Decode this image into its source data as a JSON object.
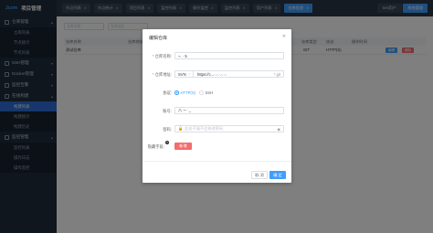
{
  "logo": {
    "mark": "Jcom",
    "title": "项目管理"
  },
  "sidebar": {
    "groups": [
      {
        "label": "仓库管理",
        "items": [
          "仓库列表",
          "节点统计",
          "节点列表"
        ]
      },
      {
        "label": "SSH管理",
        "items": []
      },
      {
        "label": "Docker管理",
        "items": []
      },
      {
        "label": "监控告警",
        "items": []
      },
      {
        "label": "在线构建",
        "items": [
          "构建列表",
          "构建统计",
          "构建历史"
        ]
      },
      {
        "label": "监控管理",
        "items": [
          "监控列表",
          "操作日志",
          "操作监控"
        ]
      }
    ],
    "active_item": "构建列表"
  },
  "topbar": {
    "tabs": [
      {
        "label": "节点列表",
        "active": false
      },
      {
        "label": "节点统计",
        "active": false
      },
      {
        "label": "项目列表",
        "active": false
      },
      {
        "label": "监控列表",
        "active": false
      },
      {
        "label": "操作监控",
        "active": false
      },
      {
        "label": "监控列表",
        "active": false
      },
      {
        "label": "用户列表",
        "active": false
      },
      {
        "label": "仓库信息",
        "active": true
      }
    ],
    "user": "test用户",
    "system_button": "系统管理"
  },
  "background": {
    "search1": "仓库名称",
    "search2": "仓库地址",
    "headers": [
      "仓库名称",
      "仓库地址",
      "仓库类型",
      "协议",
      "操作时间"
    ],
    "row": {
      "name": "测试仓库",
      "type": "GIT",
      "protocol": "HTTP(S)"
    },
    "row_actions": [
      "编辑",
      "删除"
    ]
  },
  "dialog": {
    "title": "编辑仓库",
    "fields": {
      "name_label": "仓库名称:",
      "name_value": "~.  ·  5",
      "url_label": "仓库地址:",
      "url_type": "SVN",
      "url_value": "https://c...·.·.·.·.·.·",
      "url_suffix": "*.git",
      "protocol_label": "协议:",
      "protocol_options": [
        "HTTP(S)",
        "SSH"
      ],
      "protocol_selected": "HTTP(S)",
      "account_label": "账号:",
      "account_value": "八 ~·· _",
      "password_label": "密码:",
      "password_placeholder": "此处不填不会修改密码",
      "hidden_label": "隐藏字段:",
      "add_button": "新增"
    },
    "cancel": "取 消",
    "confirm": "确 定"
  },
  "colors": {
    "primary": "#409eff",
    "danger": "#f56c6c",
    "sidebar": "#1f2d3d"
  }
}
